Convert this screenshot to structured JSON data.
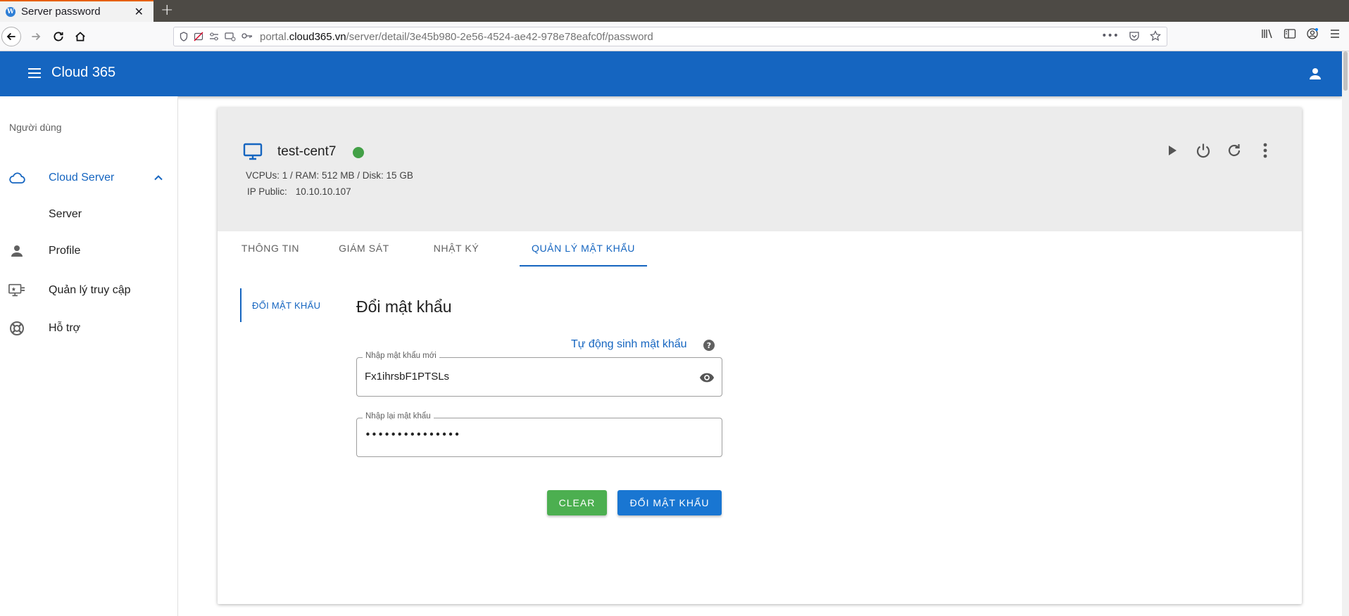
{
  "browser": {
    "tab_title": "Server password",
    "tab_favicon_letter": "W",
    "tab_close": "✕",
    "new_tab": "+",
    "url_prefix": "portal.",
    "url_domain": "cloud365.vn",
    "url_path": "/server/detail/3e45b980-2e56-4524-ae42-978e78eafc0f/password",
    "url_more": "•••"
  },
  "appbar": {
    "title": "Cloud 365"
  },
  "sidebar": {
    "header": "Người dùng",
    "items": [
      {
        "label": "Cloud Server",
        "icon": "cloud-icon",
        "active": true
      },
      {
        "label": "Server",
        "icon": "",
        "active": false
      },
      {
        "label": "Profile",
        "icon": "person-icon",
        "active": false
      },
      {
        "label": "Quản lý truy cập",
        "icon": "access-monitor-icon",
        "active": false
      },
      {
        "label": "Hỗ trợ",
        "icon": "lifebuoy-icon",
        "active": false
      }
    ]
  },
  "server": {
    "name": "test-cent7",
    "status_color": "#43a047",
    "specs": "VCPUs: 1 / RAM: 512 MB / Disk: 15 GB",
    "ip_label": "IP Public:",
    "ip_value": "10.10.10.107"
  },
  "tabs": [
    {
      "label": "THÔNG TIN",
      "active": false
    },
    {
      "label": "GIÁM SÁT",
      "active": false
    },
    {
      "label": "NHẬT KÝ",
      "active": false
    },
    {
      "label": "QUẢN LÝ MẬT KHẨU",
      "active": true
    }
  ],
  "password": {
    "subnav_label": "ĐỔI MẬT KHẨU",
    "section_title": "Đổi mật khẩu",
    "autogen_link": "Tự động sinh mật khẩu",
    "help_glyph": "?",
    "new_password_label": "Nhập mật khẩu mới",
    "new_password_value": "Fx1ihrsbF1PTSLs",
    "confirm_label": "Nhập lại mật khẩu",
    "confirm_value": "•••••••••••••••",
    "clear_button": "CLEAR",
    "change_button": "ĐỔI MẬT KHẨU"
  },
  "colors": {
    "primary": "#1565c0",
    "clear_button": "#4caf50",
    "change_button": "#1976d2",
    "header_bg": "#ececec"
  }
}
